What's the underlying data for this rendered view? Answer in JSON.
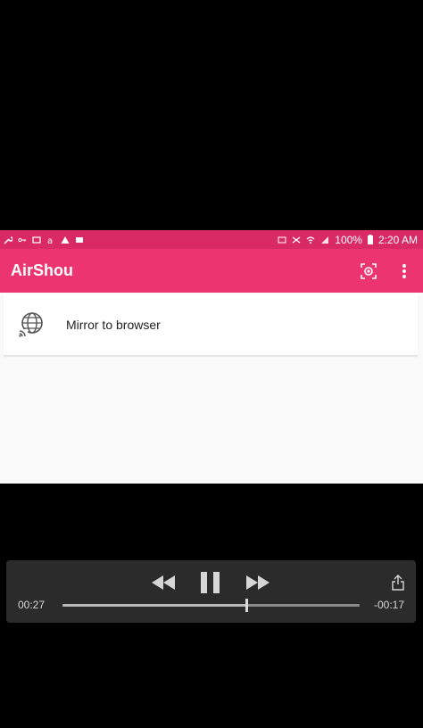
{
  "status_bar": {
    "battery": "100%",
    "time": "2:20 AM",
    "left_icons": [
      "wrench-icon",
      "key-icon",
      "photo-icon",
      "amazon-icon",
      "warning-icon",
      "image-icon"
    ],
    "right_icons": [
      "cast-icon",
      "nfc-icon",
      "wifi-icon",
      "signal-icon",
      "battery-icon"
    ]
  },
  "app_bar": {
    "title": "AirShou",
    "actions": [
      "record-icon",
      "more-vert-icon"
    ]
  },
  "list": {
    "items": [
      {
        "label": "Mirror to browser",
        "icon": "cast-browser-icon"
      }
    ]
  },
  "player": {
    "elapsed": "00:27",
    "remaining": "-00:17",
    "progress_fraction": 0.62,
    "controls": [
      "rewind-icon",
      "pause-icon",
      "fast-forward-icon",
      "share-icon"
    ]
  },
  "colors": {
    "status_bar": "#d92a66",
    "app_bar": "#ec3470",
    "player_bg": "#2b2b2b"
  }
}
